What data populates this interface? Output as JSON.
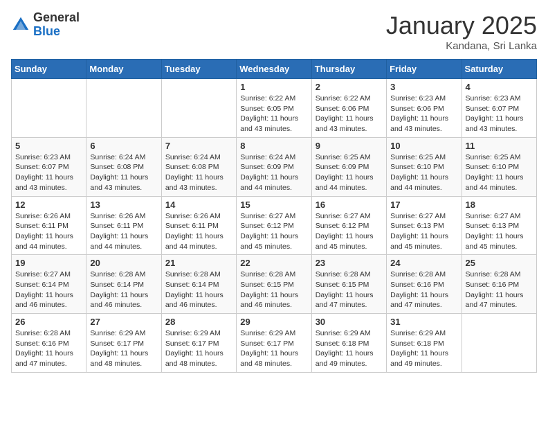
{
  "header": {
    "logo_general": "General",
    "logo_blue": "Blue",
    "title": "January 2025",
    "location": "Kandana, Sri Lanka"
  },
  "days_of_week": [
    "Sunday",
    "Monday",
    "Tuesday",
    "Wednesday",
    "Thursday",
    "Friday",
    "Saturday"
  ],
  "weeks": [
    [
      {
        "day": "",
        "sunrise": "",
        "sunset": "",
        "daylight": ""
      },
      {
        "day": "",
        "sunrise": "",
        "sunset": "",
        "daylight": ""
      },
      {
        "day": "",
        "sunrise": "",
        "sunset": "",
        "daylight": ""
      },
      {
        "day": "1",
        "sunrise": "Sunrise: 6:22 AM",
        "sunset": "Sunset: 6:05 PM",
        "daylight": "Daylight: 11 hours and 43 minutes."
      },
      {
        "day": "2",
        "sunrise": "Sunrise: 6:22 AM",
        "sunset": "Sunset: 6:06 PM",
        "daylight": "Daylight: 11 hours and 43 minutes."
      },
      {
        "day": "3",
        "sunrise": "Sunrise: 6:23 AM",
        "sunset": "Sunset: 6:06 PM",
        "daylight": "Daylight: 11 hours and 43 minutes."
      },
      {
        "day": "4",
        "sunrise": "Sunrise: 6:23 AM",
        "sunset": "Sunset: 6:07 PM",
        "daylight": "Daylight: 11 hours and 43 minutes."
      }
    ],
    [
      {
        "day": "5",
        "sunrise": "Sunrise: 6:23 AM",
        "sunset": "Sunset: 6:07 PM",
        "daylight": "Daylight: 11 hours and 43 minutes."
      },
      {
        "day": "6",
        "sunrise": "Sunrise: 6:24 AM",
        "sunset": "Sunset: 6:08 PM",
        "daylight": "Daylight: 11 hours and 43 minutes."
      },
      {
        "day": "7",
        "sunrise": "Sunrise: 6:24 AM",
        "sunset": "Sunset: 6:08 PM",
        "daylight": "Daylight: 11 hours and 43 minutes."
      },
      {
        "day": "8",
        "sunrise": "Sunrise: 6:24 AM",
        "sunset": "Sunset: 6:09 PM",
        "daylight": "Daylight: 11 hours and 44 minutes."
      },
      {
        "day": "9",
        "sunrise": "Sunrise: 6:25 AM",
        "sunset": "Sunset: 6:09 PM",
        "daylight": "Daylight: 11 hours and 44 minutes."
      },
      {
        "day": "10",
        "sunrise": "Sunrise: 6:25 AM",
        "sunset": "Sunset: 6:10 PM",
        "daylight": "Daylight: 11 hours and 44 minutes."
      },
      {
        "day": "11",
        "sunrise": "Sunrise: 6:25 AM",
        "sunset": "Sunset: 6:10 PM",
        "daylight": "Daylight: 11 hours and 44 minutes."
      }
    ],
    [
      {
        "day": "12",
        "sunrise": "Sunrise: 6:26 AM",
        "sunset": "Sunset: 6:11 PM",
        "daylight": "Daylight: 11 hours and 44 minutes."
      },
      {
        "day": "13",
        "sunrise": "Sunrise: 6:26 AM",
        "sunset": "Sunset: 6:11 PM",
        "daylight": "Daylight: 11 hours and 44 minutes."
      },
      {
        "day": "14",
        "sunrise": "Sunrise: 6:26 AM",
        "sunset": "Sunset: 6:11 PM",
        "daylight": "Daylight: 11 hours and 44 minutes."
      },
      {
        "day": "15",
        "sunrise": "Sunrise: 6:27 AM",
        "sunset": "Sunset: 6:12 PM",
        "daylight": "Daylight: 11 hours and 45 minutes."
      },
      {
        "day": "16",
        "sunrise": "Sunrise: 6:27 AM",
        "sunset": "Sunset: 6:12 PM",
        "daylight": "Daylight: 11 hours and 45 minutes."
      },
      {
        "day": "17",
        "sunrise": "Sunrise: 6:27 AM",
        "sunset": "Sunset: 6:13 PM",
        "daylight": "Daylight: 11 hours and 45 minutes."
      },
      {
        "day": "18",
        "sunrise": "Sunrise: 6:27 AM",
        "sunset": "Sunset: 6:13 PM",
        "daylight": "Daylight: 11 hours and 45 minutes."
      }
    ],
    [
      {
        "day": "19",
        "sunrise": "Sunrise: 6:27 AM",
        "sunset": "Sunset: 6:14 PM",
        "daylight": "Daylight: 11 hours and 46 minutes."
      },
      {
        "day": "20",
        "sunrise": "Sunrise: 6:28 AM",
        "sunset": "Sunset: 6:14 PM",
        "daylight": "Daylight: 11 hours and 46 minutes."
      },
      {
        "day": "21",
        "sunrise": "Sunrise: 6:28 AM",
        "sunset": "Sunset: 6:14 PM",
        "daylight": "Daylight: 11 hours and 46 minutes."
      },
      {
        "day": "22",
        "sunrise": "Sunrise: 6:28 AM",
        "sunset": "Sunset: 6:15 PM",
        "daylight": "Daylight: 11 hours and 46 minutes."
      },
      {
        "day": "23",
        "sunrise": "Sunrise: 6:28 AM",
        "sunset": "Sunset: 6:15 PM",
        "daylight": "Daylight: 11 hours and 47 minutes."
      },
      {
        "day": "24",
        "sunrise": "Sunrise: 6:28 AM",
        "sunset": "Sunset: 6:16 PM",
        "daylight": "Daylight: 11 hours and 47 minutes."
      },
      {
        "day": "25",
        "sunrise": "Sunrise: 6:28 AM",
        "sunset": "Sunset: 6:16 PM",
        "daylight": "Daylight: 11 hours and 47 minutes."
      }
    ],
    [
      {
        "day": "26",
        "sunrise": "Sunrise: 6:28 AM",
        "sunset": "Sunset: 6:16 PM",
        "daylight": "Daylight: 11 hours and 47 minutes."
      },
      {
        "day": "27",
        "sunrise": "Sunrise: 6:29 AM",
        "sunset": "Sunset: 6:17 PM",
        "daylight": "Daylight: 11 hours and 48 minutes."
      },
      {
        "day": "28",
        "sunrise": "Sunrise: 6:29 AM",
        "sunset": "Sunset: 6:17 PM",
        "daylight": "Daylight: 11 hours and 48 minutes."
      },
      {
        "day": "29",
        "sunrise": "Sunrise: 6:29 AM",
        "sunset": "Sunset: 6:17 PM",
        "daylight": "Daylight: 11 hours and 48 minutes."
      },
      {
        "day": "30",
        "sunrise": "Sunrise: 6:29 AM",
        "sunset": "Sunset: 6:18 PM",
        "daylight": "Daylight: 11 hours and 49 minutes."
      },
      {
        "day": "31",
        "sunrise": "Sunrise: 6:29 AM",
        "sunset": "Sunset: 6:18 PM",
        "daylight": "Daylight: 11 hours and 49 minutes."
      },
      {
        "day": "",
        "sunrise": "",
        "sunset": "",
        "daylight": ""
      }
    ]
  ]
}
